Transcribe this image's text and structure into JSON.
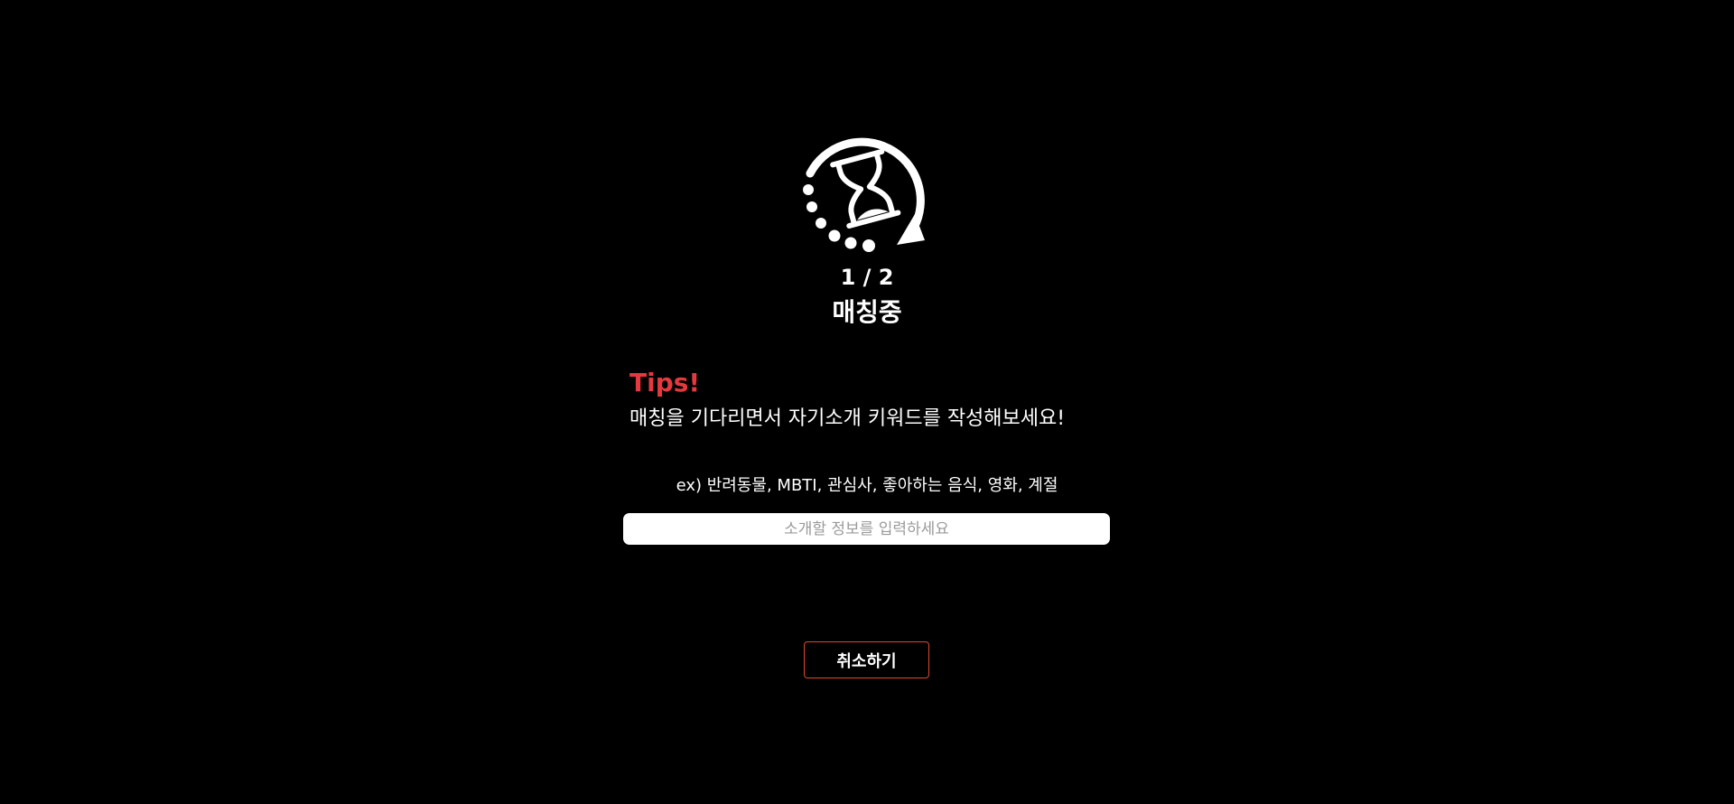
{
  "loader": {
    "icon": "hourglass-refresh-icon"
  },
  "progress": {
    "current": 1,
    "total": 2,
    "label": "1 / 2"
  },
  "status": "매칭중",
  "tips": {
    "title": "Tips!",
    "text": "매칭을 기다리면서 자기소개 키워드를 작성해보세요!"
  },
  "example": "ex) 반려동물, MBTI, 관심사, 좋아하는 음식, 영화, 계절",
  "intro_input": {
    "value": "",
    "placeholder": "소개할 정보를 입력하세요"
  },
  "cancel_button": {
    "label": "취소하기"
  },
  "colors": {
    "background": "#000000",
    "text": "#ffffff",
    "accent": "#e5393f",
    "button_border": "#e0472e"
  }
}
